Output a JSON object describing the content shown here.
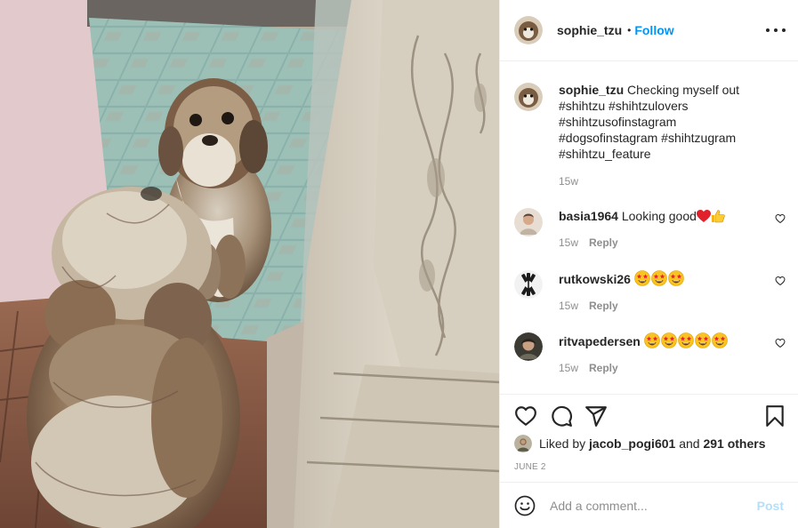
{
  "post": {
    "image_alt": "Two shih tzu dogs, one looking at its reflection in a mirror",
    "header": {
      "username": "sophie_tzu",
      "separator": "•",
      "follow_label": "Follow"
    },
    "caption": {
      "username": "sophie_tzu",
      "text": "Checking myself out",
      "hashtags": [
        "#shihtzu #shihtzulovers",
        "#shihtzusofinstagram",
        "#dogsofinstagram #shihtzugram",
        "#shihtzu_feature"
      ],
      "time": "15w"
    },
    "comments": [
      {
        "username": "basia1964",
        "text": "Looking good",
        "emojis": [
          "heart",
          "thumbs-up"
        ],
        "time": "15w",
        "reply_label": "Reply"
      },
      {
        "username": "rutkowski26",
        "text": "",
        "emojis": [
          "star-struck",
          "star-struck",
          "star-struck"
        ],
        "time": "15w",
        "reply_label": "Reply"
      },
      {
        "username": "ritvapedersen",
        "text": "",
        "emojis": [
          "star-struck",
          "star-struck",
          "star-struck",
          "star-struck",
          "star-struck"
        ],
        "time": "15w",
        "reply_label": "Reply"
      }
    ],
    "likes": {
      "prefix": "Liked by",
      "liker": "jacob_pogi601",
      "conjunction": "and",
      "others": "291 others"
    },
    "date": "JUNE 2",
    "composer": {
      "placeholder": "Add a comment...",
      "post_label": "Post"
    }
  },
  "colors": {
    "text": "#262626",
    "secondary": "#8e8e8e",
    "link": "#00376b",
    "follow": "#0095f6",
    "post_disabled": "#b2dffc",
    "divider": "#efefef"
  }
}
